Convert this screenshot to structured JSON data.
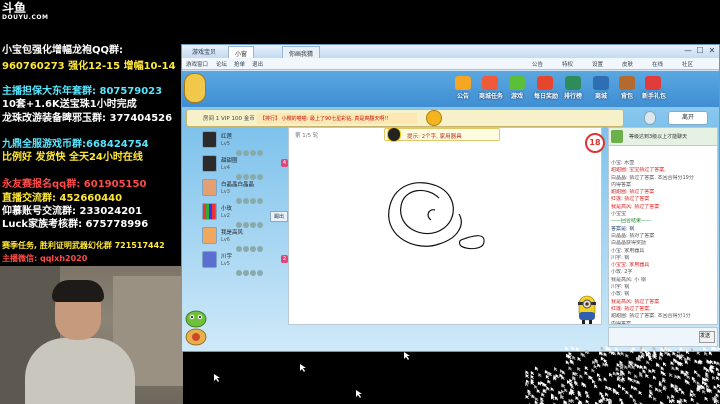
{
  "stream": {
    "logo_main": "斗鱼",
    "logo_sub": "DOUYU.COM"
  },
  "overlay": {
    "line1": "小宝包强化增幅龙袍QQ群:",
    "line2": "960760273 强化12-15 增幅10-14",
    "line3": "主播担保大东年套群: 807579023",
    "line4": "10套+1.6K送宝珠1小时完成",
    "line5": "龙珠改游装备睥邪玉群: 377404526",
    "line6": "九鼎全服游戏币群:668424754",
    "line7": "比例好 发货快 全天24小时在线",
    "line8": "永友赛报名qq群: 601905150",
    "line9": "直播交流群: 452660440",
    "line10": "仰慕账号交流群: 233024201",
    "line11": "Luck家族考核群: 675778996",
    "line12": "赛季任务, 胜利证明武器幻化群 721517442",
    "line13": "主播微信: qqlxh2020"
  },
  "window": {
    "app_title": "游戏宝贝",
    "tab1": "小窗",
    "tab2": "你画我猜",
    "nav": [
      "游戏窗口",
      "论坛",
      "抢单",
      "退出"
    ],
    "top_icons": [
      "公告",
      "特权",
      "设置",
      "皮肤",
      "在线",
      "社区"
    ],
    "minimize": "—",
    "maximize": "☐",
    "close": "✕"
  },
  "game": {
    "menu": [
      "公告",
      "商城任务",
      "游戏",
      "每日奖励",
      "排行榜",
      "商城",
      "背包",
      "新手礼包"
    ],
    "exit_label": "离开",
    "room_label": "房间 1 VIP 100 金币",
    "marquee": "【排行】 小樱的喵喵: 最上了90七星彩钻, 真是爽翻天啊!!",
    "turn_label": "第 1/5 轮",
    "hint_label": "提示: 2个字, 家用器具",
    "timer": "18",
    "kick_label": "踢出",
    "players": [
      {
        "name": "红莲",
        "level": "Lv5",
        "badge": ""
      },
      {
        "name": "甜甜圈",
        "level": "Lv4",
        "badge": "4"
      },
      {
        "name": "白晶晶白晶晶",
        "level": "Lv3",
        "badge": ""
      },
      {
        "name": "小玫",
        "level": "Lv2",
        "badge": ""
      },
      {
        "name": "我是高风",
        "level": "Lv6",
        "badge": ""
      },
      {
        "name": "川宇",
        "level": "Lv5",
        "badge": "2"
      }
    ],
    "chat_header": "等级达到3级以上才能聊天",
    "chat_lines": [
      {
        "text": "小宝: 水壶",
        "cls": "c-gray"
      },
      {
        "text": "甜甜圈: 宝宝猜过了答案,",
        "cls": "c-red"
      },
      {
        "text": "白晶晶: 猜过了答案. 本回合得分19分",
        "cls": "c-gray"
      },
      {
        "text": "内得答案",
        "cls": "c-gray"
      },
      {
        "text": "甜甜圈: 猜过了答案",
        "cls": "c-red"
      },
      {
        "text": "红莲: 猜过了答案",
        "cls": "c-red"
      },
      {
        "text": "我是高风: 猜过了答案",
        "cls": "c-red"
      },
      {
        "text": "小宝宝",
        "cls": "c-gray"
      },
      {
        "text": "——回合结束——",
        "cls": "c-green"
      },
      {
        "text": "答案是: 锅",
        "cls": "c-blue"
      },
      {
        "text": "白晶晶: 猜对了答案",
        "cls": "c-gray"
      },
      {
        "text": "白晶晶获得奖励",
        "cls": "c-gray"
      },
      {
        "text": "小宝: 家用器具",
        "cls": "c-gray"
      },
      {
        "text": "川宇: 锅",
        "cls": "c-gray"
      },
      {
        "text": "小宝宝: 家用器具",
        "cls": "c-red"
      },
      {
        "text": "小玫: 2字",
        "cls": "c-gray"
      },
      {
        "text": "我是高风: 小 锅",
        "cls": "c-gray"
      },
      {
        "text": "川宇: 锅",
        "cls": "c-gray"
      },
      {
        "text": "小玫: 锅",
        "cls": "c-gray"
      },
      {
        "text": "我是高风: 猜过了答案",
        "cls": "c-red"
      },
      {
        "text": "红莲: 猜过了答案,",
        "cls": "c-red"
      },
      {
        "text": "甜甜圈: 猜过了答案. 本回合得分1分",
        "cls": "c-gray"
      },
      {
        "text": "内得答案",
        "cls": "c-gray"
      },
      {
        "text": "白晶晶: 猜过了答案",
        "cls": "c-red"
      },
      {
        "text": "小宝: 整本",
        "cls": "c-gray"
      }
    ],
    "send_label": "发送"
  },
  "colors": {
    "overlay_white": "#ffffff",
    "overlay_yellow": "#ffe838",
    "overlay_cyan": "#58e6ff",
    "overlay_red": "#ff4a4a",
    "window_border": "#6d97c4",
    "timer_red": "#dd3333"
  }
}
